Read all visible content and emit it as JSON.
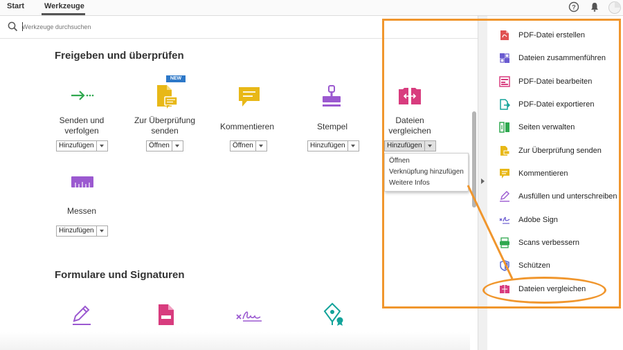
{
  "topbar": {
    "tabs": [
      {
        "label": "Start"
      },
      {
        "label": "Werkzeuge"
      }
    ],
    "icons": [
      "help-icon",
      "bell-icon",
      "user-avatar-icon"
    ]
  },
  "search": {
    "placeholder": "Werkzeuge durchsuchen",
    "value": ""
  },
  "sections": [
    {
      "title": "Freigeben und überprüfen",
      "tools": [
        {
          "label_lines": [
            "Senden und",
            "verfolgen"
          ],
          "button": "Hinzufügen",
          "icon": "send-track-icon"
        },
        {
          "label_lines": [
            "Zur Überprüfung",
            "senden"
          ],
          "button": "Öffnen",
          "badge": "NEW",
          "icon": "send-for-review-icon"
        },
        {
          "label_lines": [
            "Kommentieren"
          ],
          "button": "Öffnen",
          "icon": "comment-icon"
        },
        {
          "label_lines": [
            "Stempel"
          ],
          "button": "Hinzufügen",
          "icon": "stamp-icon"
        },
        {
          "label_lines": [
            "Dateien",
            "vergleichen"
          ],
          "button": "Hinzufügen",
          "icon": "compare-files-icon"
        },
        {
          "label_lines": [
            "Messen"
          ],
          "button": "Hinzufügen",
          "icon": "measure-icon"
        }
      ]
    },
    {
      "title": "Formulare und Signaturen",
      "tools": [
        {
          "icon": "fill-sign-icon"
        },
        {
          "icon": "prepare-form-icon"
        },
        {
          "icon": "adobe-sign-icon"
        },
        {
          "icon": "certificates-icon"
        }
      ]
    }
  ],
  "dropdown": {
    "items": [
      "Öffnen",
      "Verknüpfung hinzufügen",
      "Weitere Infos"
    ]
  },
  "right_panel": {
    "items": [
      {
        "label": "PDF-Datei erstellen",
        "icon": "create-pdf-icon"
      },
      {
        "label": "Dateien zusammenführen",
        "icon": "combine-files-icon"
      },
      {
        "label": "PDF-Datei bearbeiten",
        "icon": "edit-pdf-icon"
      },
      {
        "label": "PDF-Datei exportieren",
        "icon": "export-pdf-icon"
      },
      {
        "label": "Seiten verwalten",
        "icon": "organize-pages-icon"
      },
      {
        "label": "Zur Überprüfung senden",
        "icon": "send-for-review-icon"
      },
      {
        "label": "Kommentieren",
        "icon": "comment-icon"
      },
      {
        "label": "Ausfüllen und unterschreiben",
        "icon": "fill-sign-icon"
      },
      {
        "label": "Adobe Sign",
        "icon": "adobe-sign-icon"
      },
      {
        "label": "Scans verbessern",
        "icon": "enhance-scans-icon"
      },
      {
        "label": "Schützen",
        "icon": "protect-icon"
      },
      {
        "label": "Dateien vergleichen",
        "icon": "compare-files-icon"
      }
    ]
  },
  "colors": {
    "highlight": "#f0962d",
    "green": "#2fa84f",
    "yellow": "#e8b817",
    "purple": "#9b59d0",
    "pink": "#d83c7e",
    "teal": "#13a39a",
    "blue_badge": "#2d78c8"
  }
}
